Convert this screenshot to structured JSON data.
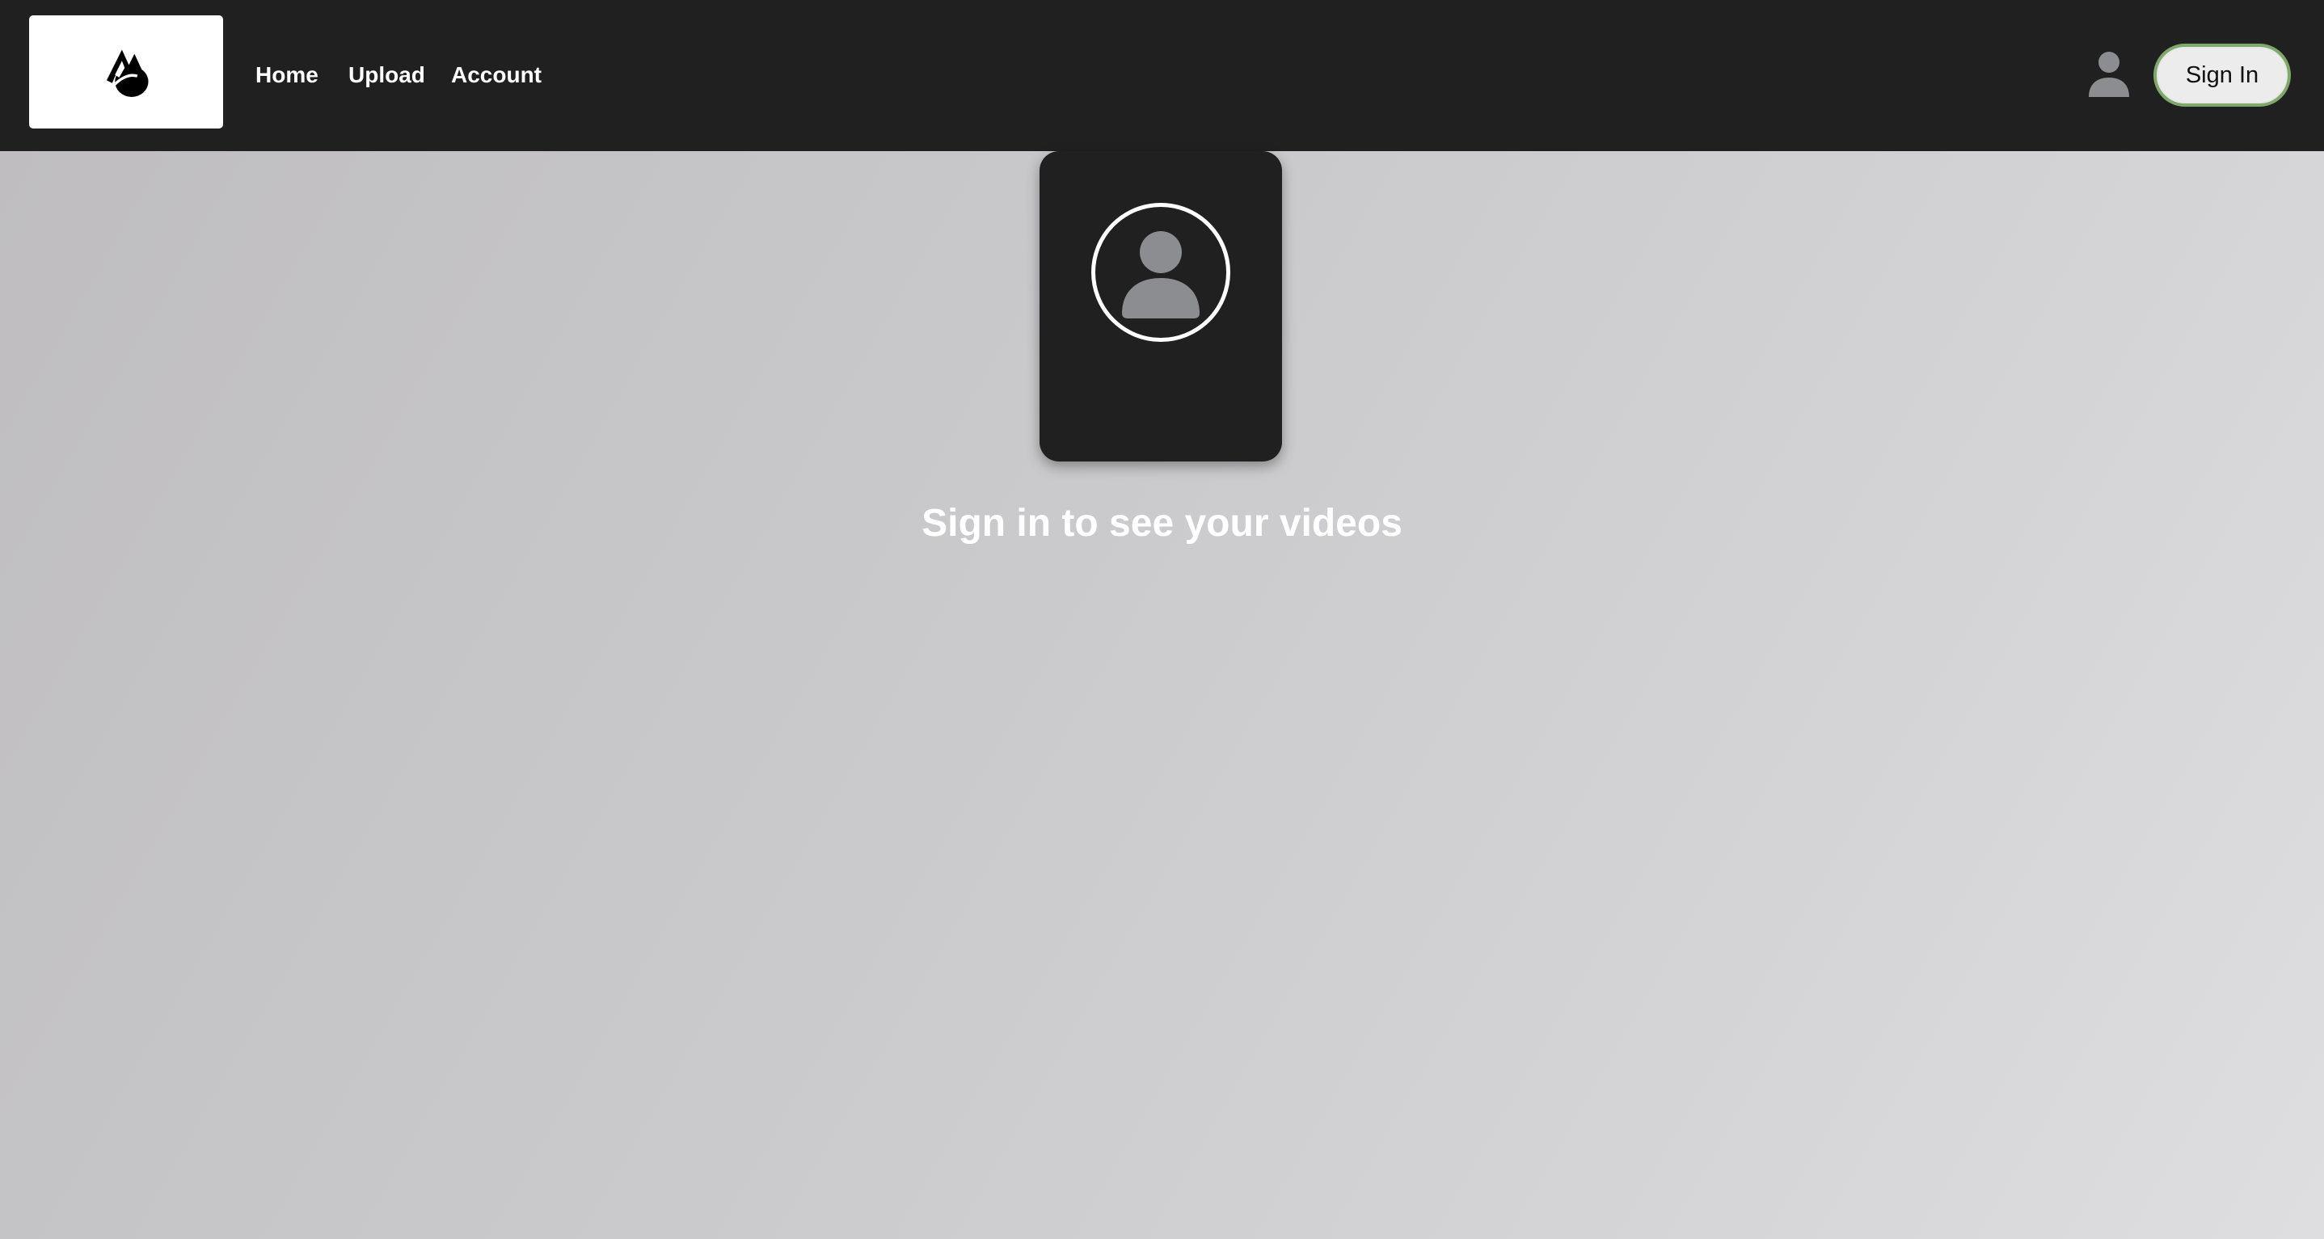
{
  "header": {
    "nav": {
      "home": "Home",
      "upload": "Upload",
      "account": "Account"
    },
    "signin_label": "Sign In",
    "icons": {
      "logo": "mountain-peak-logo",
      "user": "user-avatar-icon"
    }
  },
  "main": {
    "message": "Sign in to see your videos",
    "card_icon": "user-avatar-icon"
  },
  "colors": {
    "header_bg": "#202020",
    "card_bg": "#202020",
    "signin_border": "#7ea96b",
    "avatar_gray": "#8c8d90"
  }
}
